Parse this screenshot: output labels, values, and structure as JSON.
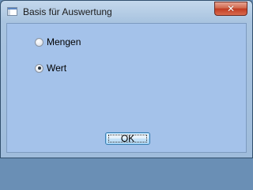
{
  "window": {
    "title": "Basis für Auswertung",
    "close_glyph": "✕"
  },
  "options": [
    {
      "label": "Mengen",
      "checked": false
    },
    {
      "label": "Wert",
      "checked": true
    }
  ],
  "buttons": {
    "ok_label": "OK"
  },
  "colors": {
    "client_bg": "#a4c2ea",
    "close_button": "#c13b22"
  }
}
